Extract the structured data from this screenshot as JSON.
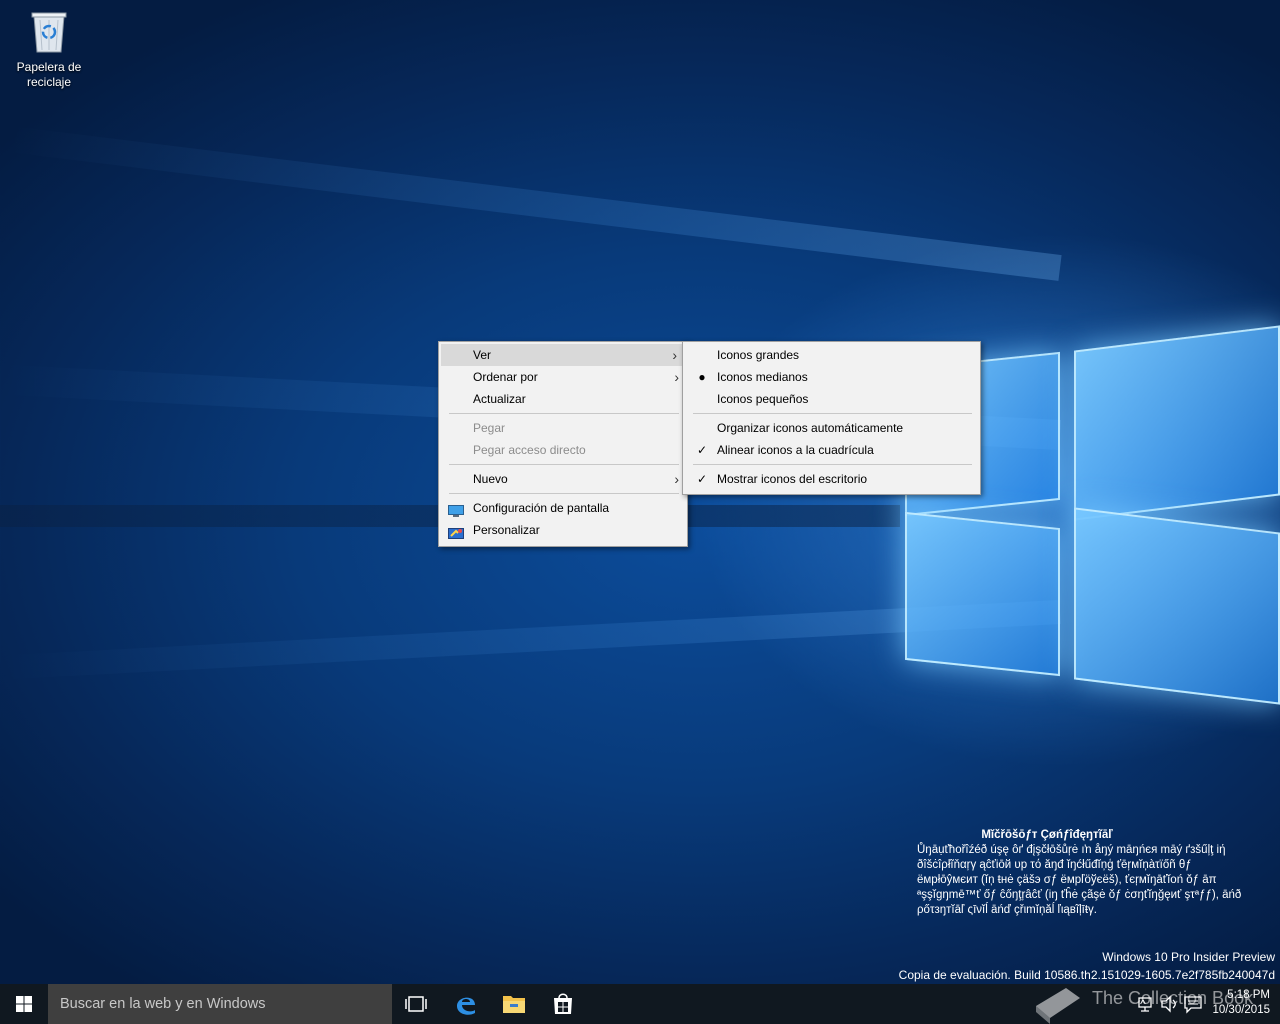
{
  "desktop": {
    "recycle_bin_label_line1": "Papelera de",
    "recycle_bin_label_line2": "reciclaje"
  },
  "context_menu": {
    "items": [
      {
        "label": "Ver",
        "has_submenu": true,
        "highlighted": true
      },
      {
        "label": "Ordenar por",
        "has_submenu": true
      },
      {
        "label": "Actualizar"
      },
      {
        "label": "Pegar",
        "disabled": true
      },
      {
        "label": "Pegar acceso directo",
        "disabled": true
      },
      {
        "label": "Nuevo",
        "has_submenu": true
      },
      {
        "label": "Configuración de pantalla",
        "icon": "display-icon"
      },
      {
        "label": "Personalizar",
        "icon": "personalize-icon"
      }
    ]
  },
  "view_submenu": {
    "items": [
      {
        "label": "Iconos grandes"
      },
      {
        "label": "Iconos medianos",
        "mark": "bullet"
      },
      {
        "label": "Iconos pequeños"
      },
      {
        "label": "Organizar iconos automáticamente"
      },
      {
        "label": "Alinear iconos a la cuadrícula",
        "mark": "check"
      },
      {
        "label": "Mostrar iconos del escritorio",
        "mark": "check"
      }
    ]
  },
  "watermark": {
    "title": "Mĭčřōšōƒт Çøńƒîđęŋтĩāľ",
    "lines": [
      "Ůŋāụťħořîźéð úşę ôґ đįşčłōšůŗė ıŉ åŋý māŋńєя māý ґзšűļţ іή",
      "ðîšċîρłĩňαŗγ ąĉťіōй υр τό ăŋđ ĭŋćłűđĭņģ ťēŗмĭņàτïőñ θƒ",
      "ёмрłōŷмєит (ĭņ ŧнė çäšэ σƒ ёмрľöўєёš), ťєŗмĭŋāťĭоń ŏƒ āπ",
      "ªşşĭgŋmē™ť őƒ ĉőŋţŗâĉť (іŋ ťĥė çãşė ŏƒ ċσŋťĭŋğęиť şτªƒƒ), āńð",
      "ρőτзŋтĭāľ ςīνĭĺ āńď çřιmĭņăĺ ľιąвĩļīŧγ."
    ]
  },
  "build": {
    "edition": "Windows 10 Pro Insider Preview",
    "copy": "Copia de evaluación. Build 10586.th2.151029-1605.7e2f785fb240047d"
  },
  "taskbar": {
    "search_placeholder": "Buscar en la web y en Windows",
    "time": "5:18 PM",
    "date": "10/30/2015",
    "brand_watermark": "The Collection Book"
  }
}
